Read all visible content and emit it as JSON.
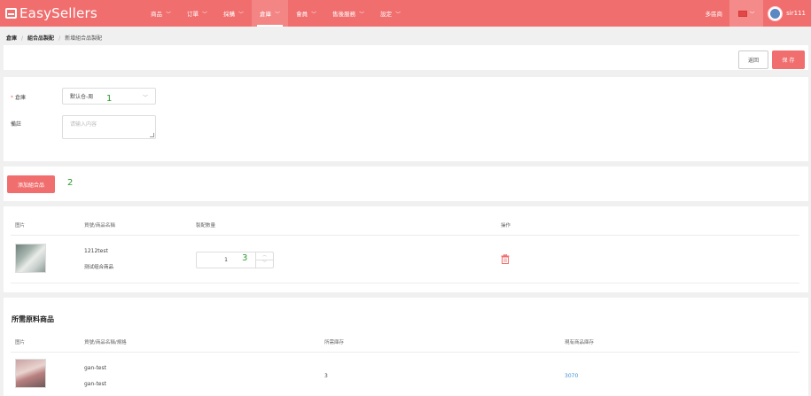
{
  "app": {
    "name": "EasySellers"
  },
  "nav": {
    "items": [
      {
        "label": "商品",
        "active": false
      },
      {
        "label": "订單",
        "active": false
      },
      {
        "label": "採購",
        "active": false
      },
      {
        "label": "倉庫",
        "active": true
      },
      {
        "label": "會員",
        "active": false
      },
      {
        "label": "售後服務",
        "active": false
      },
      {
        "label": "設定",
        "active": false
      }
    ],
    "multi_store": "多區商",
    "username": "sir111"
  },
  "breadcrumb": [
    "倉庫",
    "組合品製配",
    "新增組合品製配"
  ],
  "toolbar": {
    "back_label": "返回",
    "save_label": "保 存"
  },
  "form": {
    "warehouse_label": "倉庫",
    "warehouse_value": "默认仓-周",
    "remark_label": "備註",
    "remark_placeholder": "请输入内容"
  },
  "add_button_label": "添加組合品",
  "combo_table": {
    "headers": [
      "图片",
      "貨號/商品名稱",
      "製配數量",
      "操作"
    ],
    "rows": [
      {
        "sku": "1212test",
        "name": "测试组合商品",
        "quantity": "1"
      }
    ]
  },
  "materials": {
    "title": "所需原料商品",
    "headers": [
      "图片",
      "貨號/商品名稱/規格",
      "所需庫存",
      "現有商品庫存"
    ],
    "rows": [
      {
        "sku": "gan-test",
        "name": "gan-test",
        "required": "3",
        "stock": "3070"
      }
    ]
  },
  "annotations": [
    "1",
    "2",
    "3"
  ],
  "colors": {
    "brand": "#f06e6e",
    "link": "#3d8fd9",
    "annotation": "#2d9b2d"
  }
}
